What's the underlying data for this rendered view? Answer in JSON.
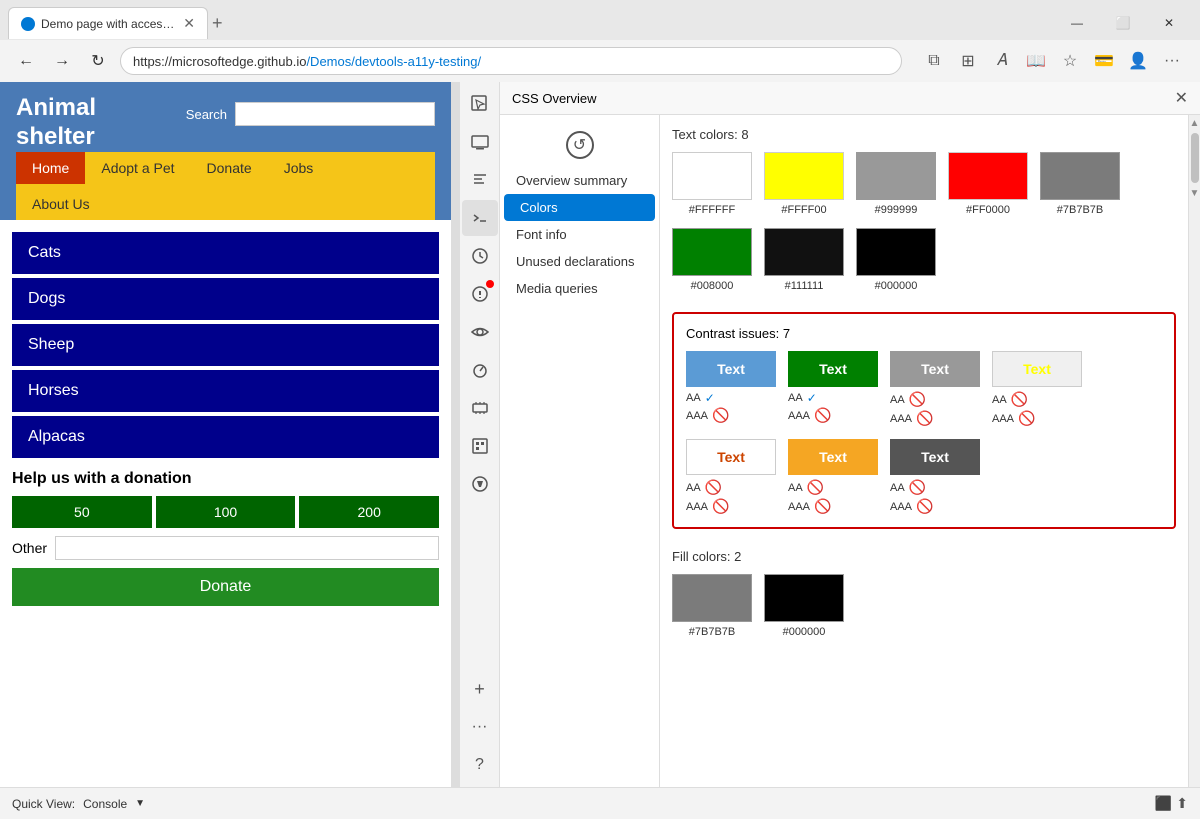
{
  "browser": {
    "tab_title": "Demo page with accessibility issu",
    "url_prefix": "https://microsoftedge.github.io",
    "url_path": "/Demos/devtools-a11y-testing/",
    "new_tab_label": "+",
    "win_minimize": "—",
    "win_maximize": "⬜",
    "win_close": "✕"
  },
  "website": {
    "logo_line1": "Animal",
    "logo_line2": "shelter",
    "search_label": "Search",
    "nav_items": [
      "Home",
      "Adopt a Pet",
      "Donate",
      "Jobs"
    ],
    "nav_about": "About Us",
    "animals": [
      "Cats",
      "Dogs",
      "Sheep",
      "Horses",
      "Alpacas"
    ],
    "donation_title": "Help us with a donation",
    "donation_amounts": [
      "50",
      "100",
      "200"
    ],
    "other_label": "Other",
    "donate_btn": "Donate"
  },
  "devtools": {
    "panel_title": "CSS Overview",
    "close_label": "✕",
    "menu_items": [
      {
        "label": "Overview summary",
        "active": false
      },
      {
        "label": "Colors",
        "active": true
      },
      {
        "label": "Font info",
        "active": false
      },
      {
        "label": "Unused declarations",
        "active": false
      },
      {
        "label": "Media queries",
        "active": false
      }
    ],
    "text_colors_title": "Text colors: 8",
    "text_colors": [
      {
        "hex": "#FFFFFF",
        "bg": "#FFFFFF",
        "border": "#ccc"
      },
      {
        "hex": "#FFFF00",
        "bg": "#FFFF00",
        "border": "#ccc"
      },
      {
        "hex": "#999999",
        "bg": "#999999",
        "border": "#ccc"
      },
      {
        "hex": "#FF0000",
        "bg": "#FF0000",
        "border": "#ccc"
      },
      {
        "hex": "#7B7B7B",
        "bg": "#7B7B7B",
        "border": "#ccc"
      },
      {
        "hex": "#008000",
        "bg": "#008000",
        "border": "#ccc"
      },
      {
        "hex": "#111111",
        "bg": "#111111",
        "border": "#ccc"
      },
      {
        "hex": "#000000",
        "bg": "#000000",
        "border": "#ccc"
      }
    ],
    "contrast_title": "Contrast issues: 7",
    "contrast_items": [
      {
        "label": "Text",
        "text_color": "#fff",
        "bg_color": "#5b9bd5",
        "aa": "AA",
        "aa_pass": true,
        "aaa": "AAA",
        "aaa_pass": false
      },
      {
        "label": "Text",
        "text_color": "#fff",
        "bg_color": "#008000",
        "aa": "AA",
        "aa_pass": true,
        "aaa": "AAA",
        "aaa_pass": false
      },
      {
        "label": "Text",
        "text_color": "#fff",
        "bg_color": "#999999",
        "aa": "AA",
        "aa_pass": false,
        "aaa": "AAA",
        "aaa_pass": false
      },
      {
        "label": "Text",
        "text_color": "#ffff00",
        "bg_color": "#f0f0f0",
        "aa": "AA",
        "aa_pass": false,
        "aaa": "AAA",
        "aaa_pass": false
      },
      {
        "label": "Text",
        "text_color": "#ff6600",
        "bg_color": "#fff",
        "aa": "AA",
        "aa_pass": false,
        "aaa": "AAA",
        "aaa_pass": false
      },
      {
        "label": "Text",
        "text_color": "#fff",
        "bg_color": "#f5a623",
        "aa": "AA",
        "aa_pass": false,
        "aaa": "AAA",
        "aaa_pass": false
      },
      {
        "label": "Text",
        "text_color": "#fff",
        "bg_color": "#555555",
        "aa": "AA",
        "aa_pass": false,
        "aaa": "AAA",
        "aaa_pass": false
      }
    ],
    "fill_colors_title": "Fill colors: 2",
    "fill_colors": [
      {
        "hex": "#7B7B7B",
        "bg": "#7B7B7B"
      },
      {
        "hex": "#000000",
        "bg": "#000000"
      }
    ]
  },
  "bottom_bar": {
    "quick_view_label": "Quick View:",
    "console_label": "Console",
    "chevron": "▼"
  },
  "icons": {
    "back": "←",
    "forward": "→",
    "refresh": "↻",
    "sidebar_inspector": "⬜",
    "sidebar_console": "⌨",
    "sidebar_sources": "</>",
    "sidebar_network": "☁",
    "sidebar_performance": "📊",
    "sidebar_memory": "💾",
    "sidebar_application": "⚙",
    "sidebar_security": "🛡",
    "sidebar_accessibility": "👁",
    "sidebar_css": "🎨",
    "sidebar_issues": "⚠",
    "sidebar_add": "+",
    "sidebar_help": "?",
    "sidebar_more": "···"
  }
}
